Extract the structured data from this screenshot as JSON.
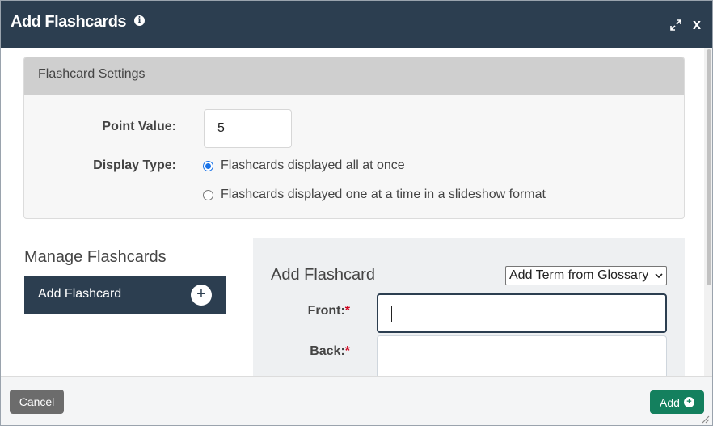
{
  "header": {
    "title": "Add Flashcards",
    "info_icon": "info-icon",
    "expand_icon": "expand-icon",
    "close_label": "x"
  },
  "settings": {
    "heading": "Flashcard Settings",
    "point_value_label": "Point Value:",
    "point_value": "5",
    "display_type_label": "Display Type:",
    "options": [
      {
        "label": "Flashcards displayed all at once",
        "selected": true
      },
      {
        "label": "Flashcards displayed one at a time in a slideshow format",
        "selected": false
      }
    ]
  },
  "manage": {
    "title": "Manage Flashcards",
    "add_button_label": "Add Flashcard",
    "add_button_icon": "plus-circle-icon"
  },
  "editor": {
    "title": "Add Flashcard",
    "glossary_select": "Add Term from Glossary",
    "front_label": "Front:",
    "back_label": "Back:",
    "required_marker": "*",
    "front_value": "",
    "back_value": ""
  },
  "footer": {
    "cancel_label": "Cancel",
    "add_label": "Add"
  },
  "colors": {
    "header_bg": "#2c3e50",
    "add_button": "#14805e",
    "cancel_button": "#6c6c6c",
    "required": "#d0011b",
    "radio_selected": "#1a73e8"
  }
}
